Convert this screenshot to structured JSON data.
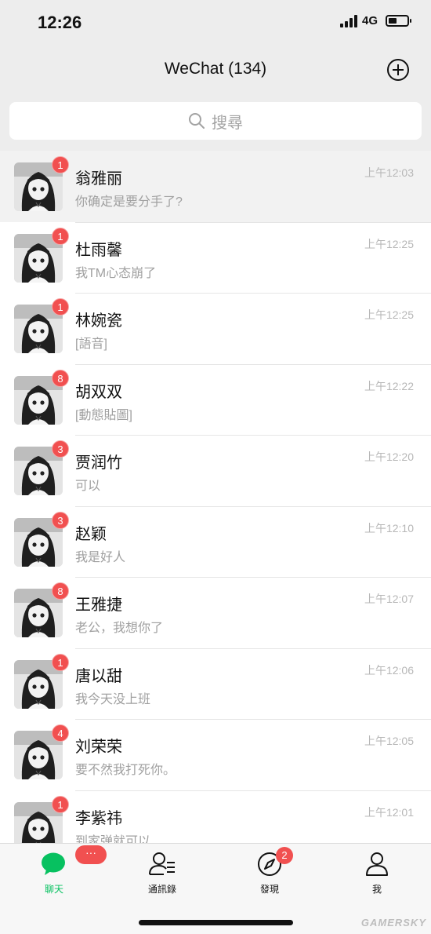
{
  "status_bar": {
    "time": "12:26",
    "network": "4G",
    "battery_level": 0.45
  },
  "nav": {
    "title": "WeChat (134)"
  },
  "search": {
    "placeholder": "搜尋"
  },
  "chats": [
    {
      "name": "翁雅丽",
      "preview": "你确定是要分手了?",
      "time": "上午12:03",
      "unread": "1",
      "pinned": true
    },
    {
      "name": "杜雨馨",
      "preview": "我TM心态崩了",
      "time": "上午12:25",
      "unread": "1",
      "pinned": false
    },
    {
      "name": "林婉瓷",
      "preview": "[語音]",
      "time": "上午12:25",
      "unread": "1",
      "pinned": false
    },
    {
      "name": "胡双双",
      "preview": "[動態貼圖]",
      "time": "上午12:22",
      "unread": "8",
      "pinned": false
    },
    {
      "name": "贾润竹",
      "preview": "可以",
      "time": "上午12:20",
      "unread": "3",
      "pinned": false
    },
    {
      "name": "赵颖",
      "preview": "我是好人",
      "time": "上午12:10",
      "unread": "3",
      "pinned": false
    },
    {
      "name": "王雅捷",
      "preview": "老公，我想你了",
      "time": "上午12:07",
      "unread": "8",
      "pinned": false
    },
    {
      "name": "唐以甜",
      "preview": "我今天没上班",
      "time": "上午12:06",
      "unread": "1",
      "pinned": false
    },
    {
      "name": "刘荣荣",
      "preview": "要不然我打死你。",
      "time": "上午12:05",
      "unread": "4",
      "pinned": false
    },
    {
      "name": "李紫祎",
      "preview": "到家弹就可以",
      "time": "上午12:01",
      "unread": "1",
      "pinned": false
    }
  ],
  "tabs": [
    {
      "label": "聊天",
      "icon": "chat-bubble-icon",
      "badge": "···",
      "active": true
    },
    {
      "label": "通訊錄",
      "icon": "contacts-icon",
      "badge": "",
      "active": false
    },
    {
      "label": "發現",
      "icon": "compass-icon",
      "badge": "2",
      "active": false
    },
    {
      "label": "我",
      "icon": "person-icon",
      "badge": "",
      "active": false
    }
  ],
  "watermark": "GAMERSKY",
  "colors": {
    "accent": "#07c160",
    "badge": "#f15050",
    "background": "#ededed"
  }
}
